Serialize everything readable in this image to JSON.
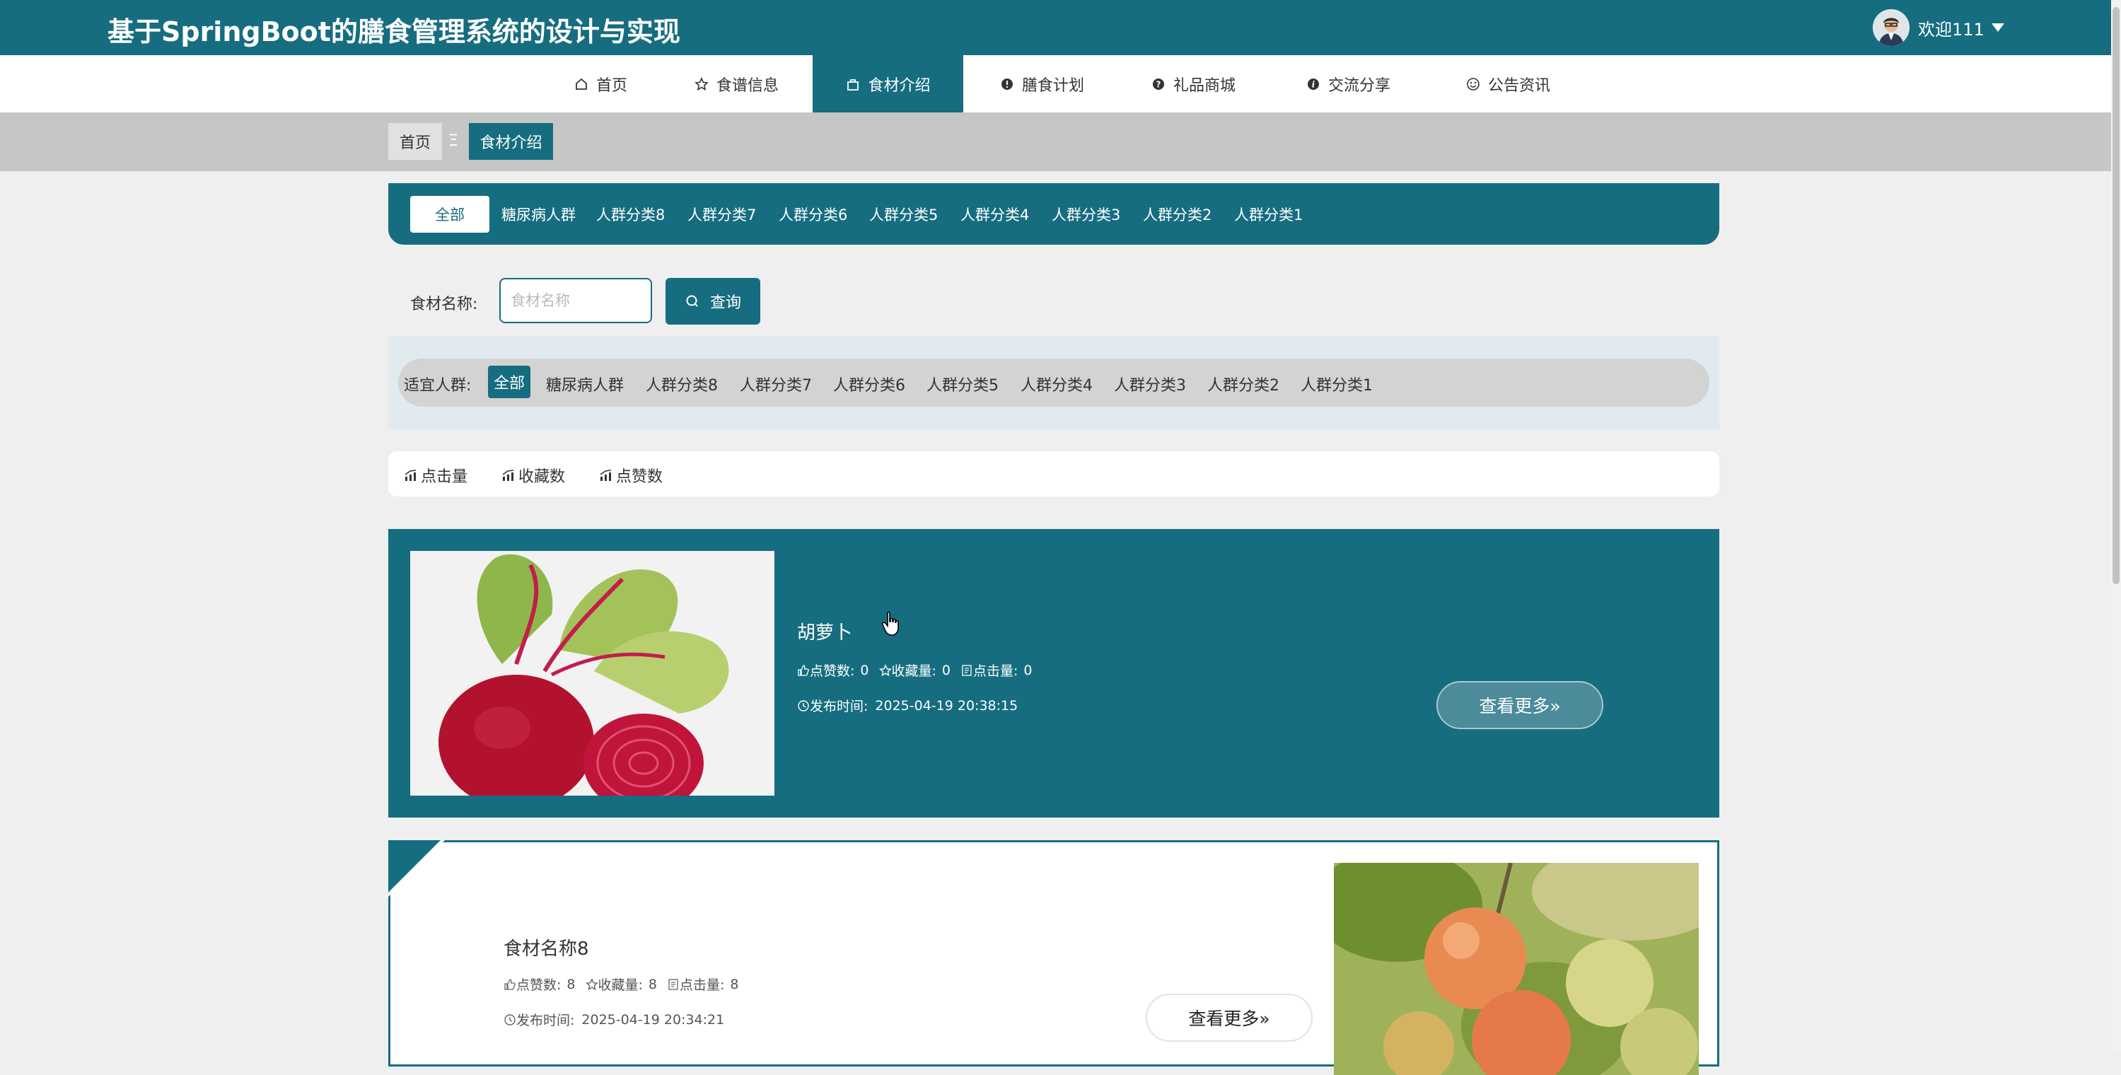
{
  "header": {
    "site_title": "基于SpringBoot的膳食管理系统的设计与实现",
    "welcome": "欢迎111"
  },
  "nav": {
    "items": [
      {
        "label": "首页",
        "icon": "home-icon"
      },
      {
        "label": "食谱信息",
        "icon": "star-icon"
      },
      {
        "label": "食材介绍",
        "icon": "bag-icon",
        "active": true
      },
      {
        "label": "膳食计划",
        "icon": "info-icon"
      },
      {
        "label": "礼品商城",
        "icon": "question-icon"
      },
      {
        "label": "交流分享",
        "icon": "italic-info-icon"
      },
      {
        "label": "公告资讯",
        "icon": "smile-icon"
      }
    ]
  },
  "breadcrumb": {
    "home": "首页",
    "separator": "Ξ",
    "current": "食材介绍"
  },
  "categories": [
    "全部",
    "糖尿病人群",
    "人群分类8",
    "人群分类7",
    "人群分类6",
    "人群分类5",
    "人群分类4",
    "人群分类3",
    "人群分类2",
    "人群分类1"
  ],
  "search": {
    "label": "食材名称:",
    "placeholder": "食材名称",
    "value": "",
    "button": "查询"
  },
  "crowd_filter": {
    "label": "适宜人群:",
    "options": [
      "全部",
      "糖尿病人群",
      "人群分类8",
      "人群分类7",
      "人群分类6",
      "人群分类5",
      "人群分类4",
      "人群分类3",
      "人群分类2",
      "人群分类1"
    ]
  },
  "sort": [
    "点击量",
    "收藏数",
    "点赞数"
  ],
  "cards": [
    {
      "title": "胡萝卜",
      "likes_label": "点赞数:",
      "likes": "0",
      "favs_label": "收藏量:",
      "favs": "0",
      "clicks_label": "点击量:",
      "clicks": "0",
      "time_label": "发布时间:",
      "time": "2025-04-19 20:38:15",
      "more": "查看更多»"
    },
    {
      "title": "食材名称8",
      "likes_label": "点赞数:",
      "likes": "8",
      "favs_label": "收藏量:",
      "favs": "8",
      "clicks_label": "点击量:",
      "clicks": "8",
      "time_label": "发布时间:",
      "time": "2025-04-19 20:34:21",
      "more": "查看更多»"
    }
  ],
  "colors": {
    "primary": "#166d80",
    "page_bg": "#efefef",
    "crumb_bg": "#c6c6c6"
  }
}
